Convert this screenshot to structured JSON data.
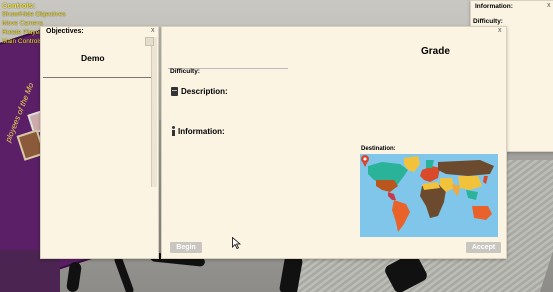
{
  "controls": {
    "title": "Controls:",
    "lines": [
      "Show/Hide Objectives",
      "Move Camera",
      "Rotate Player",
      "Main Controls"
    ]
  },
  "background": {
    "poster_text": "ployees of the Mo"
  },
  "info_panel": {
    "title": "Information:",
    "difficulty_label": "Difficulty:",
    "close": "x"
  },
  "objectives_panel": {
    "title": "Objectives:",
    "close": "x",
    "items": [
      "Demo"
    ]
  },
  "mission_panel": {
    "close": "x",
    "grade_label": "Grade",
    "difficulty_label": "Difficulty:",
    "description_label": "Description:",
    "information_label": "Information:",
    "destination_label": "Destination:",
    "begin_label": "Begin",
    "accept_label": "Accept"
  },
  "colors": {
    "panel_bg": "#fbf4e3",
    "controls_text": "#f2e030",
    "ocean": "#7fc6ea",
    "button_disabled": "#c9c6c0",
    "map_pin": "#d9462f"
  },
  "icons": [
    "book-icon",
    "info-icon",
    "close-icon",
    "map-pin-icon",
    "mouse-cursor-icon"
  ]
}
